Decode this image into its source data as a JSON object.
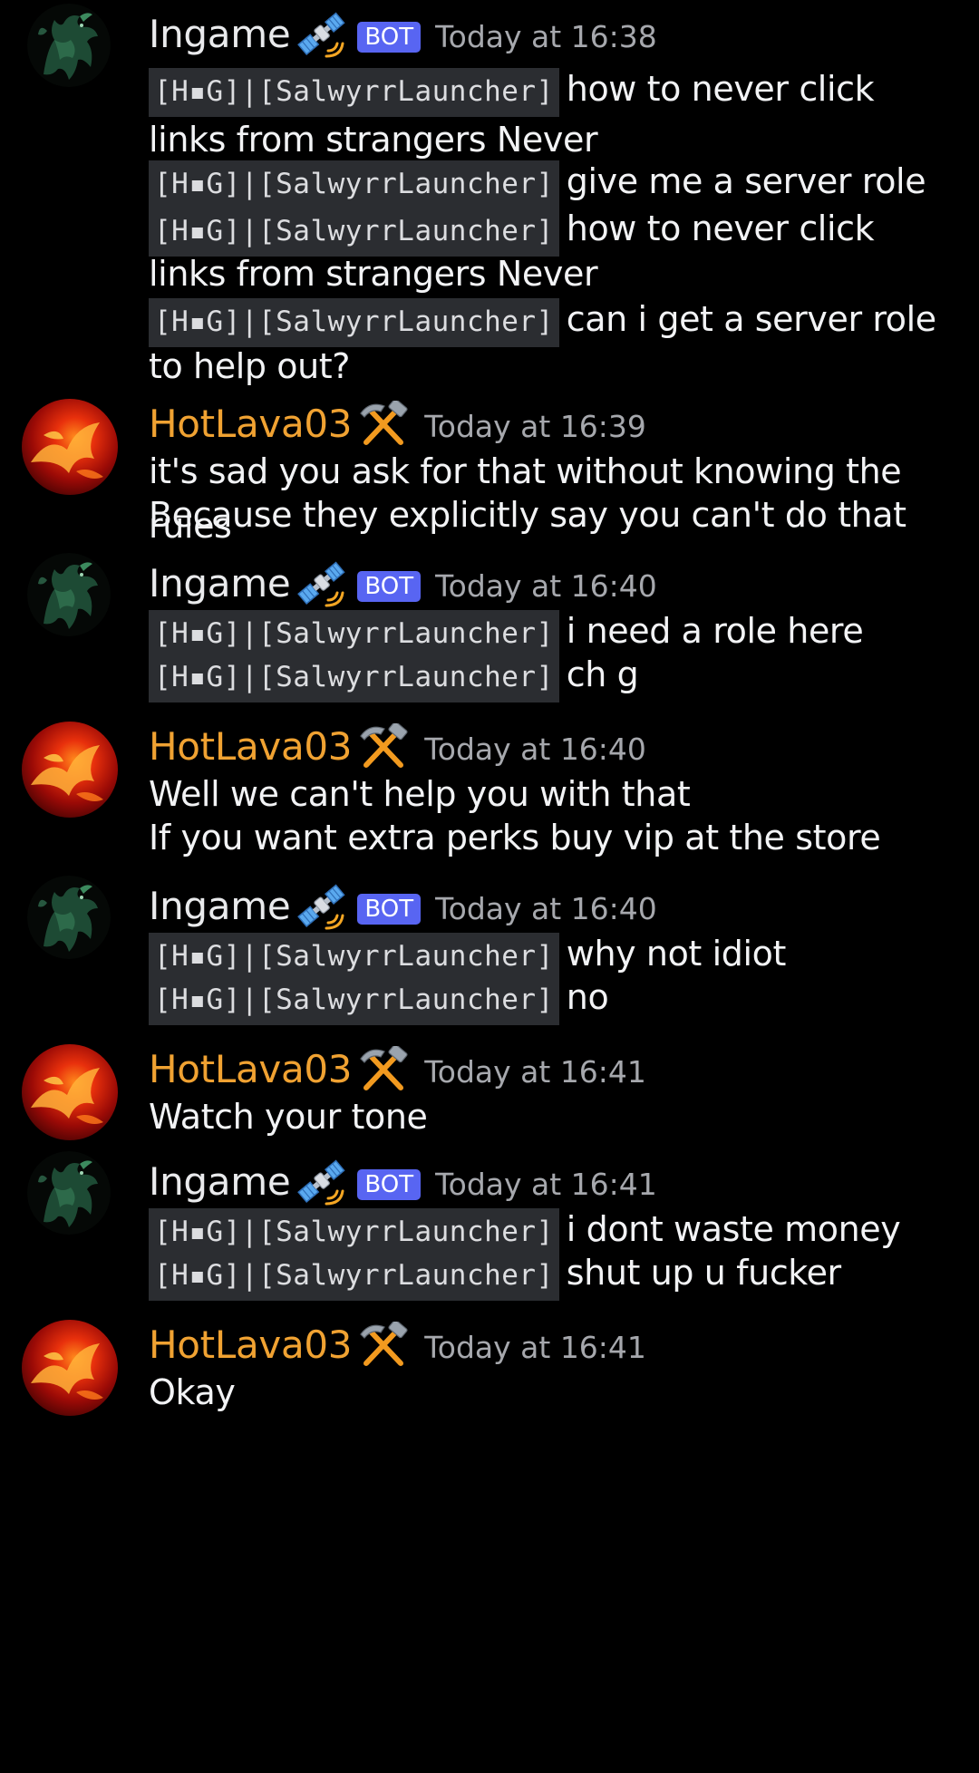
{
  "colors": {
    "background": "#000000",
    "bot_tag": "#5865f2",
    "lava_name": "#f0a232",
    "timestamp": "#a6a8ad",
    "code_bg": "#2b2d31"
  },
  "prefix": "[H▪G]|[SalwyrrLauncher]",
  "messages": [
    {
      "author": "Ingame",
      "role_icon": "satellite-icon",
      "bot_tag": "BOT",
      "time": "Today at 16:38",
      "lines": [
        {
          "prefix": "[H▪G]|[SalwyrrLauncher]",
          "text": "how to never click"
        },
        {
          "prefix": "",
          "text": "links from strangers Never"
        },
        {
          "prefix": "[H▪G]|[SalwyrrLauncher]",
          "text": "give me a server role"
        },
        {
          "prefix": "[H▪G]|[SalwyrrLauncher]",
          "text": "how to never click"
        },
        {
          "prefix": "",
          "text": "links from strangers Never"
        },
        {
          "prefix": "[H▪G]|[SalwyrrLauncher]",
          "text": "can i get a server role"
        },
        {
          "prefix": "",
          "text": "to help out?"
        }
      ]
    },
    {
      "author": "HotLava03",
      "role_icon": "hammer-pick-icon",
      "time": "Today at 16:39",
      "lines": [
        {
          "text": "it's sad you ask for that without knowing the rules"
        },
        {
          "text": "Because they explicitly say you can't do that"
        }
      ]
    },
    {
      "author": "Ingame",
      "role_icon": "satellite-icon",
      "bot_tag": "BOT",
      "time": "Today at 16:40",
      "lines": [
        {
          "prefix": "[H▪G]|[SalwyrrLauncher]",
          "text": "i need a role here"
        },
        {
          "prefix": "[H▪G]|[SalwyrrLauncher]",
          "text": "ch g"
        }
      ]
    },
    {
      "author": "HotLava03",
      "role_icon": "hammer-pick-icon",
      "time": "Today at 16:40",
      "lines": [
        {
          "text": "Well we can't help you with that"
        },
        {
          "text": "If you want extra perks buy vip at the store"
        }
      ]
    },
    {
      "author": "Ingame",
      "role_icon": "satellite-icon",
      "bot_tag": "BOT",
      "time": "Today at 16:40",
      "lines": [
        {
          "prefix": "[H▪G]|[SalwyrrLauncher]",
          "text": "why not idiot"
        },
        {
          "prefix": "[H▪G]|[SalwyrrLauncher]",
          "text": "no"
        }
      ]
    },
    {
      "author": "HotLava03",
      "role_icon": "hammer-pick-icon",
      "time": "Today at 16:41",
      "lines": [
        {
          "text": "Watch your tone"
        }
      ]
    },
    {
      "author": "Ingame",
      "role_icon": "satellite-icon",
      "bot_tag": "BOT",
      "time": "Today at 16:41",
      "lines": [
        {
          "prefix": "[H▪G]|[SalwyrrLauncher]",
          "text": "i dont waste money"
        },
        {
          "prefix": "[H▪G]|[SalwyrrLauncher]",
          "text": "shut up u fucker"
        }
      ]
    },
    {
      "author": "HotLava03",
      "role_icon": "hammer-pick-icon",
      "time": "Today at 16:41",
      "lines": [
        {
          "text": "Okay"
        }
      ]
    }
  ]
}
